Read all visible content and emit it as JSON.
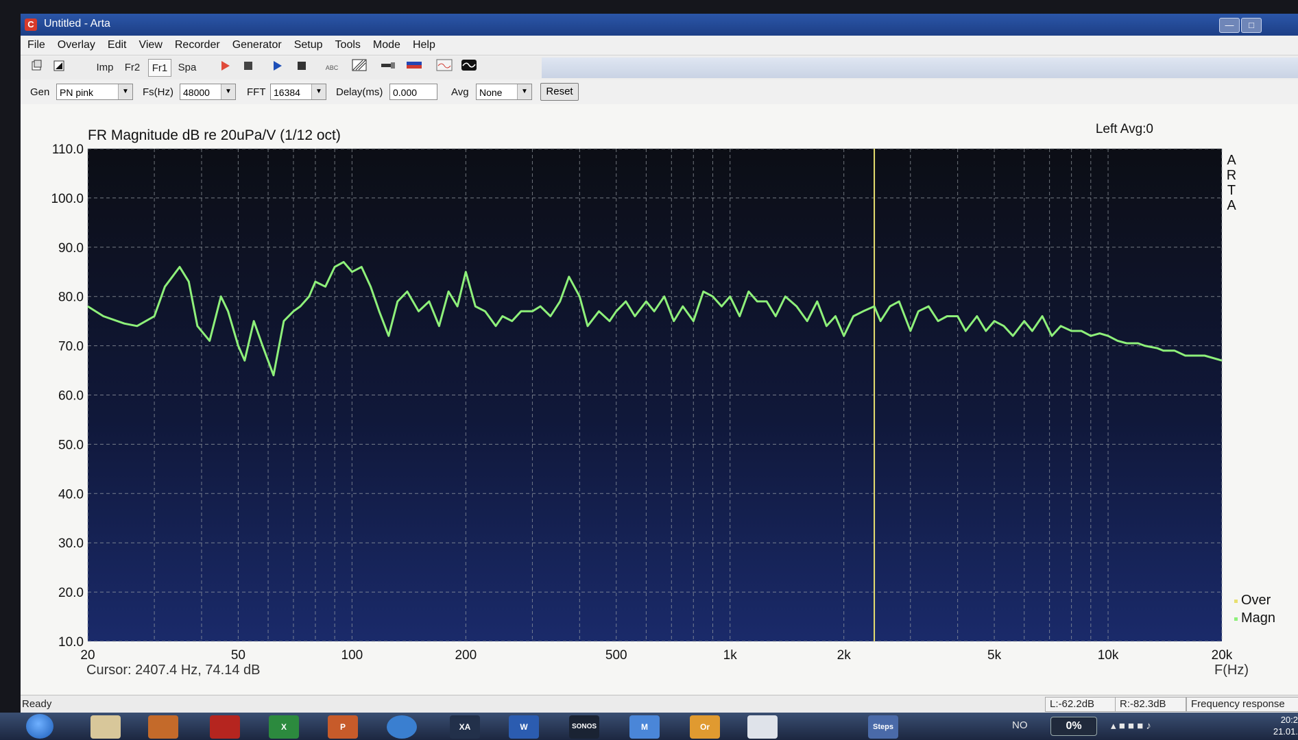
{
  "window": {
    "title": "Untitled - Arta",
    "minimize": "—",
    "maximize": "□"
  },
  "menu": [
    "File",
    "Overlay",
    "Edit",
    "View",
    "Recorder",
    "Generator",
    "Setup",
    "Tools",
    "Mode",
    "Help"
  ],
  "toolbar": {
    "imp": "Imp",
    "fr2": "Fr2",
    "fr1": "Fr1",
    "spa": "Spa",
    "abc": "ABC"
  },
  "controls": {
    "gen_label": "Gen",
    "gen_value": "PN pink",
    "fs_label": "Fs(Hz)",
    "fs_value": "48000",
    "fft_label": "FFT",
    "fft_value": "16384",
    "delay_label": "Delay(ms)",
    "delay_value": "0.000",
    "avg_label": "Avg",
    "avg_value": "None",
    "reset": "Reset"
  },
  "plot": {
    "channel_info": "Left  Avg:0",
    "brand": [
      "A",
      "R",
      "T",
      "A"
    ],
    "legend": [
      "Over",
      "Magn"
    ],
    "cursor_readout": "Cursor:  2407.4 Hz, 74.14 dB"
  },
  "status": {
    "ready": "Ready",
    "left_level": "L:-62.2dB",
    "right_level": "R:-82.3dB",
    "mode": "Frequency response"
  },
  "taskbar": {
    "apps": [
      "",
      "",
      "",
      "X",
      "P",
      "",
      "XA",
      "W",
      "SONOS",
      "M",
      "Or",
      "",
      "",
      "Steps"
    ],
    "lang": "NO",
    "percent": "0%",
    "time": "20:2",
    "date": "21.01."
  },
  "chart_data": {
    "type": "line",
    "title": "FR Magnitude dB re 20uPa/V (1/12 oct)",
    "xlabel": "F(Hz)",
    "ylabel": "",
    "x_scale": "log",
    "xlim": [
      20,
      20000
    ],
    "ylim": [
      10,
      110
    ],
    "x_ticks": [
      20,
      50,
      100,
      200,
      500,
      1000,
      2000,
      5000,
      10000,
      20000
    ],
    "x_tick_labels": [
      "20",
      "50",
      "100",
      "200",
      "500",
      "1k",
      "2k",
      "5k",
      "10k",
      "20k"
    ],
    "y_ticks": [
      10,
      20,
      30,
      40,
      50,
      60,
      70,
      80,
      90,
      100,
      110
    ],
    "y_tick_labels": [
      "10.0",
      "20.0",
      "30.0",
      "40.0",
      "50.0",
      "60.0",
      "70.0",
      "80.0",
      "90.0",
      "100.0",
      "110.0"
    ],
    "grid": true,
    "cursor_x": 2407.4,
    "series": [
      {
        "name": "Magn",
        "color": "#8ef07a",
        "x": [
          20,
          22,
          25,
          27,
          30,
          32,
          35,
          37,
          39,
          42,
          45,
          47,
          50,
          52,
          55,
          58,
          62,
          66,
          70,
          73,
          77,
          80,
          85,
          90,
          95,
          100,
          106,
          112,
          118,
          125,
          132,
          140,
          150,
          160,
          170,
          180,
          190,
          200,
          212,
          225,
          240,
          250,
          265,
          280,
          300,
          315,
          335,
          355,
          375,
          400,
          420,
          450,
          480,
          500,
          530,
          560,
          600,
          630,
          670,
          710,
          750,
          800,
          850,
          900,
          950,
          1000,
          1060,
          1120,
          1180,
          1250,
          1320,
          1400,
          1500,
          1600,
          1700,
          1800,
          1900,
          2000,
          2120,
          2250,
          2407,
          2500,
          2650,
          2800,
          3000,
          3150,
          3350,
          3550,
          3750,
          4000,
          4200,
          4500,
          4750,
          5000,
          5300,
          5600,
          6000,
          6300,
          6700,
          7100,
          7500,
          8000,
          8500,
          9000,
          9500,
          10000,
          10600,
          11200,
          12000,
          12500,
          13500,
          14000,
          15000,
          16000,
          17000,
          18000,
          20000
        ],
        "y": [
          78,
          76,
          74.5,
          74,
          76,
          82,
          86,
          83,
          74,
          71,
          80,
          77,
          70,
          67,
          75,
          70,
          64,
          75,
          77,
          78,
          80,
          83,
          82,
          86,
          87,
          85,
          86,
          82,
          77,
          72,
          79,
          81,
          77,
          79,
          74,
          81,
          78,
          85,
          78,
          77,
          74,
          76,
          75,
          77,
          77,
          78,
          76,
          79,
          84,
          80,
          74,
          77,
          75,
          77,
          79,
          76,
          79,
          77,
          80,
          75,
          78,
          75,
          81,
          80,
          78,
          80,
          76,
          81,
          79,
          79,
          76,
          80,
          78,
          75,
          79,
          74,
          76,
          72,
          76,
          77,
          78,
          75,
          78,
          79,
          73,
          77,
          78,
          75,
          76,
          76,
          73,
          76,
          73,
          75,
          74,
          72,
          75,
          73,
          76,
          72,
          74,
          73,
          73,
          72,
          72.5,
          72,
          71,
          70.5,
          70.5,
          70,
          69.5,
          69,
          69,
          68,
          68,
          68,
          67
        ]
      }
    ]
  }
}
